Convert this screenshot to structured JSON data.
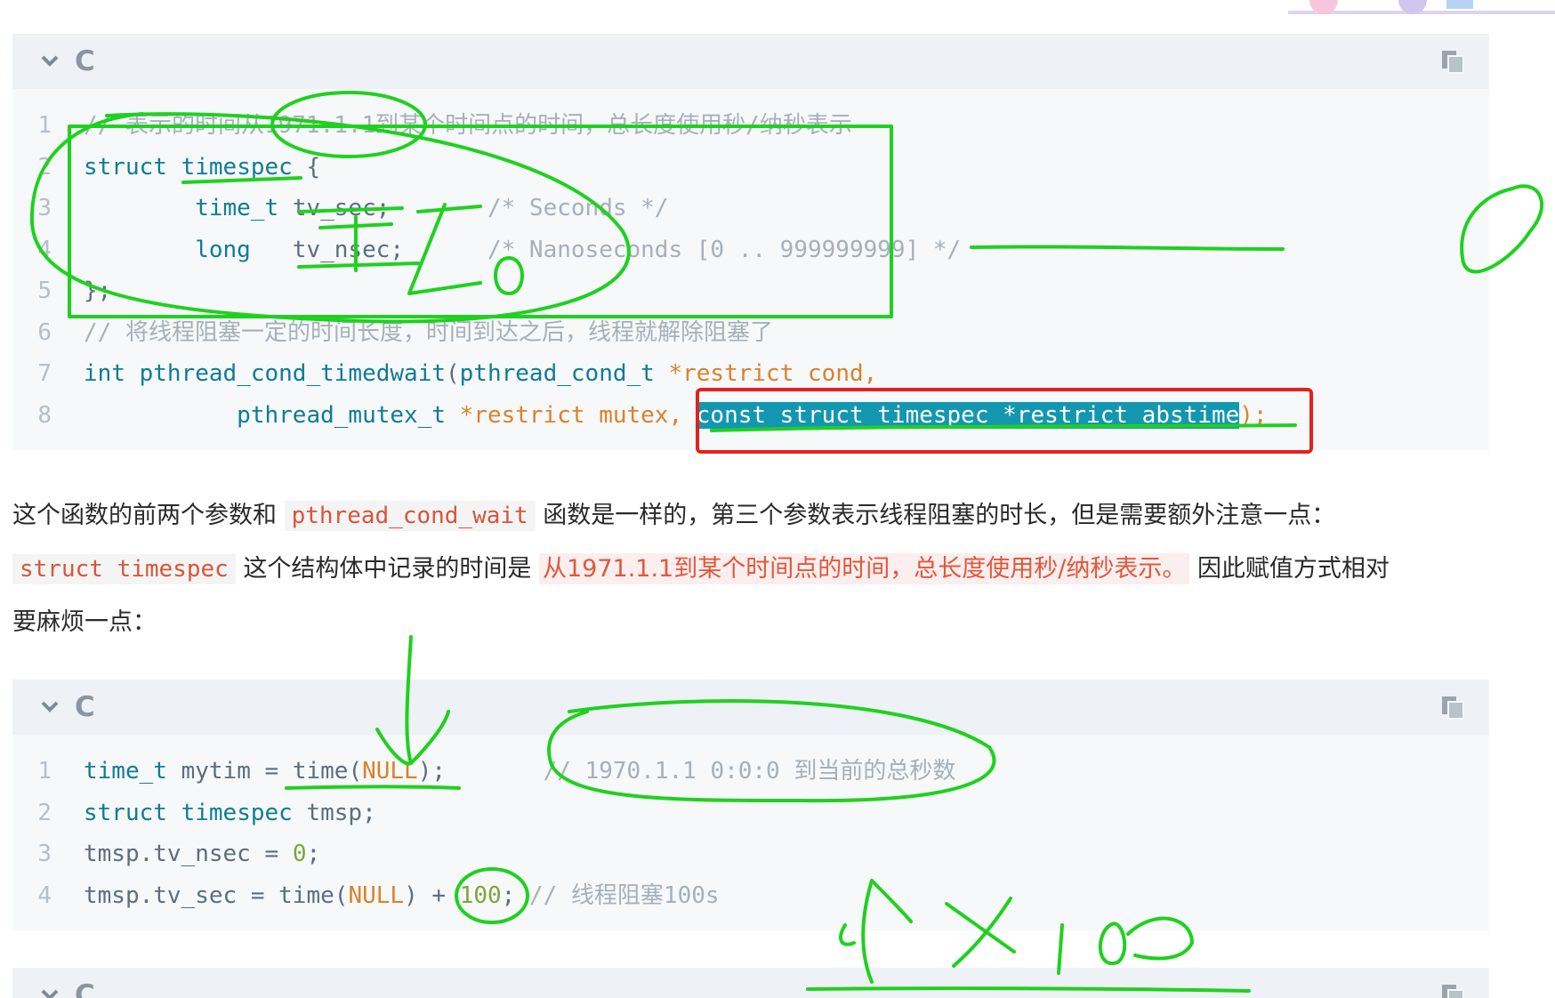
{
  "block1": {
    "language": "C",
    "lines": [
      {
        "n": "1",
        "parts": [
          {
            "t": "// 表示的时间从1971.1.1到某个时间点的时间，总长度使用秒/纳秒表示",
            "c": "comment"
          }
        ]
      },
      {
        "n": "2",
        "parts": [
          {
            "t": "struct ",
            "c": "kw"
          },
          {
            "t": "timespec",
            "c": "type"
          },
          {
            "t": " {",
            "c": "punc"
          }
        ]
      },
      {
        "n": "3",
        "parts": [
          {
            "t": "        time_t ",
            "c": "type"
          },
          {
            "t": "tv_sec;",
            "c": "plain"
          },
          {
            "t": "       /* Seconds */",
            "c": "comment"
          }
        ]
      },
      {
        "n": "4",
        "parts": [
          {
            "t": "        long ",
            "c": "kw"
          },
          {
            "t": "  tv_nsec;",
            "c": "plain"
          },
          {
            "t": "      /* Nanoseconds [0 .. 999999999] */",
            "c": "comment"
          }
        ]
      },
      {
        "n": "5",
        "parts": [
          {
            "t": "};",
            "c": "punc"
          }
        ]
      },
      {
        "n": "6",
        "parts": [
          {
            "t": "// 将线程阻塞一定的时间长度，时间到达之后，线程就解除阻塞了",
            "c": "comment"
          }
        ]
      },
      {
        "n": "7",
        "parts": [
          {
            "t": "int ",
            "c": "kw"
          },
          {
            "t": "pthread_cond_timedwait",
            "c": "type"
          },
          {
            "t": "(",
            "c": "punc"
          },
          {
            "t": "pthread_cond_t ",
            "c": "type"
          },
          {
            "t": "*restrict ",
            "c": "str"
          },
          {
            "t": "cond,",
            "c": "str"
          }
        ]
      },
      {
        "n": "8",
        "parts": [
          {
            "t": "           pthread_mutex_t ",
            "c": "type"
          },
          {
            "t": "*restrict ",
            "c": "str"
          },
          {
            "t": "mutex, ",
            "c": "str"
          },
          {
            "t": "const struct timespec *restrict abstime",
            "c": "sel"
          },
          {
            "t": ");",
            "c": "str"
          }
        ]
      }
    ]
  },
  "prose": {
    "line1_a": "这个函数的前两个参数和",
    "line1_code": "pthread_cond_wait",
    "line1_b": "函数是一样的，第三个参数表示线程阻塞的时长，但是需要额外注意一点：",
    "line2_code": "struct timespec",
    "line2_a": "这个结构体中记录的时间是",
    "line2_highlight": "从1971.1.1到某个时间点的时间，总长度使用秒/纳秒表示。",
    "line2_b": "因此赋值方式相对",
    "line3": "要麻烦一点："
  },
  "block2": {
    "language": "C",
    "lines": [
      {
        "n": "1",
        "parts": [
          {
            "t": "time_t ",
            "c": "type"
          },
          {
            "t": "mytim = ",
            "c": "plain"
          },
          {
            "t": "time",
            "c": "plain"
          },
          {
            "t": "(",
            "c": "punc"
          },
          {
            "t": "NULL",
            "c": "str"
          },
          {
            "t": ");",
            "c": "punc"
          },
          {
            "t": "       // 1970.1.1 0:0:0 到当前的总秒数",
            "c": "comment"
          }
        ]
      },
      {
        "n": "2",
        "parts": [
          {
            "t": "struct ",
            "c": "kw"
          },
          {
            "t": "timespec ",
            "c": "type"
          },
          {
            "t": "tmsp;",
            "c": "plain"
          }
        ]
      },
      {
        "n": "3",
        "parts": [
          {
            "t": "tmsp.tv_nsec = ",
            "c": "plain"
          },
          {
            "t": "0",
            "c": "num"
          },
          {
            "t": ";",
            "c": "punc"
          }
        ]
      },
      {
        "n": "4",
        "parts": [
          {
            "t": "tmsp.tv_sec = ",
            "c": "plain"
          },
          {
            "t": "time",
            "c": "plain"
          },
          {
            "t": "(",
            "c": "punc"
          },
          {
            "t": "NULL",
            "c": "str"
          },
          {
            "t": ") + ",
            "c": "punc"
          },
          {
            "t": "100",
            "c": "num"
          },
          {
            "t": ";",
            "c": "punc"
          },
          {
            "t": " // 线程阻塞100s",
            "c": "comment"
          }
        ]
      }
    ]
  },
  "block3": {
    "language": "C"
  },
  "colors": {
    "annotation_green": "#1fd11f",
    "annotation_red": "#e3211d",
    "selection": "#1397b1",
    "keyword": "#0f7c96",
    "string": "#d9822b"
  }
}
